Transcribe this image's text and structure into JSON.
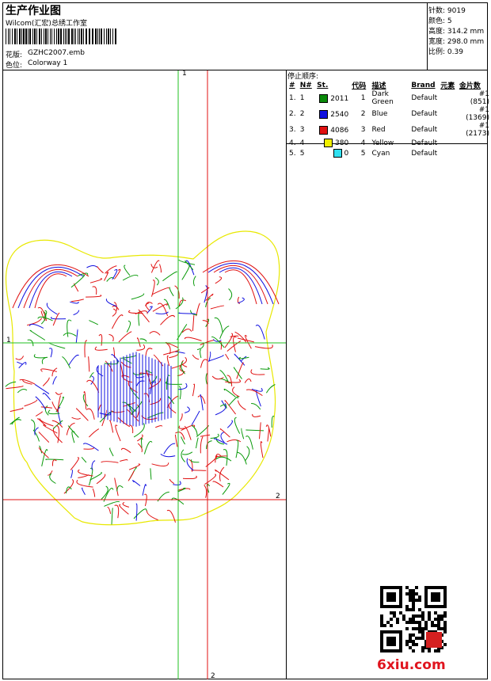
{
  "header": {
    "title": "生产作业图",
    "company": "Wilcom(汇宏)总绣工作室",
    "design_label": "花版:",
    "design_value": "GZHC2007.emb",
    "colorway_label": "色位:",
    "colorway_value": "Colorway 1"
  },
  "stats": [
    {
      "label": "针数:",
      "value": "9019"
    },
    {
      "label": "颜色:",
      "value": "5"
    },
    {
      "label": "高度:",
      "value": "314.2 mm"
    },
    {
      "label": "宽度:",
      "value": "298.0 mm"
    },
    {
      "label": "比例:",
      "value": "0.39"
    }
  ],
  "stop_sequence": {
    "title": "停止顺序:",
    "headers": [
      "#",
      "N#",
      "St.",
      "代码",
      "描述",
      "Brand",
      "元素",
      "金片数"
    ],
    "rows": [
      {
        "idx": "1.",
        "n": "1",
        "color": "#0a8a0a",
        "st": "2011",
        "code": "1",
        "desc": "Dark Green",
        "brand": "Default",
        "element": "",
        "seq": "#1 (851)"
      },
      {
        "idx": "2.",
        "n": "2",
        "color": "#1010e0",
        "st": "2540",
        "code": "2",
        "desc": "Blue",
        "brand": "Default",
        "element": "",
        "seq": "#1 (1369)"
      },
      {
        "idx": "3.",
        "n": "3",
        "color": "#e01010",
        "st": "4086",
        "code": "3",
        "desc": "Red",
        "brand": "Default",
        "element": "",
        "seq": "#1 (2173)"
      },
      {
        "idx": "4.",
        "n": "4",
        "color": "#f0f000",
        "st": "380",
        "code": "4",
        "desc": "Yellow",
        "brand": "Default",
        "element": "",
        "seq": ""
      },
      {
        "idx": "5.",
        "n": "5",
        "color": "#30e0f0",
        "st": "0",
        "code": "5",
        "desc": "Cyan",
        "brand": "Default",
        "element": "",
        "seq": ""
      }
    ]
  },
  "guides": {
    "green_label": "1",
    "red_label": "2"
  },
  "watermark": "6xiu.com",
  "thread_colors": {
    "green": "#0a9a0a",
    "blue": "#1010e0",
    "red": "#e01010",
    "yellow": "#e8e800"
  }
}
